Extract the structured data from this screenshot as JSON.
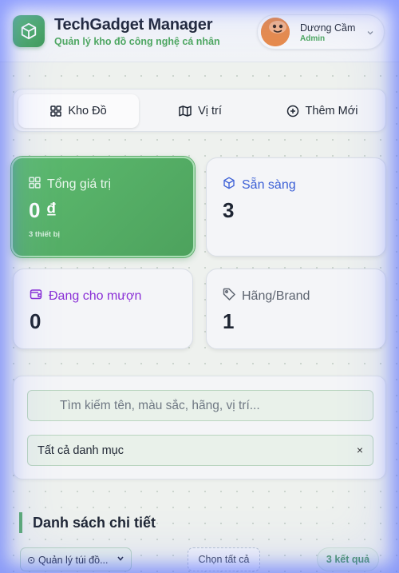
{
  "header": {
    "title": "TechGadget Manager",
    "subtitle": "Quản lý kho đồ công nghệ cá nhân",
    "user": {
      "name": "Dương Cầm",
      "role": "Admin"
    },
    "icons": {
      "logo": "cube-icon",
      "menu": "chevron-down-icon"
    }
  },
  "tabs": [
    {
      "label": "Kho Đồ",
      "icon": "grid-icon",
      "active": true
    },
    {
      "label": "Vị trí",
      "icon": "map-icon",
      "active": false
    },
    {
      "label": "Thêm Mới",
      "icon": "plus-circle-icon",
      "active": false
    }
  ],
  "stats": {
    "total_value": {
      "label": "Tổng giá trị",
      "value": "0 ₫",
      "note": "3 thiết bị",
      "icon": "grid-icon"
    },
    "ready": {
      "label": "Sẵn sàng",
      "value": "3",
      "icon": "box-icon"
    },
    "lent": {
      "label": "Đang cho mượn",
      "value": "0",
      "icon": "wallet-icon"
    },
    "brand": {
      "label": "Hãng/Brand",
      "value": "1",
      "icon": "tag-icon"
    }
  },
  "filters": {
    "search_placeholder": "Tìm kiếm tên, màu sắc, hãng, vị trí...",
    "category_value": "Tất cả danh mục",
    "clear_symbol": "×"
  },
  "list": {
    "title": "Danh sách chi tiết",
    "group_select": "⊙ Quản lý túi đồ...",
    "select_all": "Chọn tất cả",
    "result_count": "3 kết quả"
  },
  "colors": {
    "accent_green": "#4ea85f",
    "ready_blue": "#3b5fd6",
    "lent_purple": "#8a2fd6",
    "brand_gray": "#5d6470"
  }
}
